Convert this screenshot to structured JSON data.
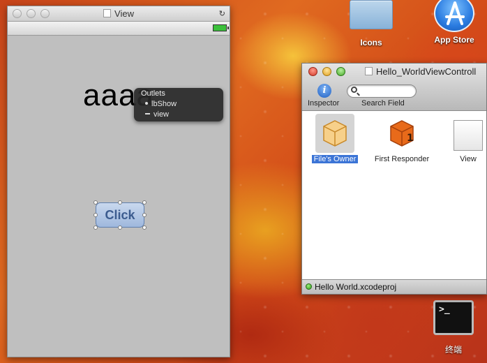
{
  "desktop": {
    "icons_folder_label": "Icons",
    "app_store_label": "App Store",
    "terminal_label": "终端",
    "terminal_prompt": ">_"
  },
  "view_window": {
    "title": "View",
    "label_text": "aaaa",
    "button_label": "Click"
  },
  "outlets_popup": {
    "header": "Outlets",
    "items": [
      "lbShow",
      "view"
    ]
  },
  "doc_window": {
    "title": "Hello_WorldViewControll",
    "inspector_label": "Inspector",
    "search_label": "Search Field",
    "search_value": "",
    "objects": [
      {
        "label": "File's Owner"
      },
      {
        "label": "First Responder"
      },
      {
        "label": "View"
      }
    ],
    "status_text": "Hello World.xcodeproj"
  },
  "colors": {
    "selection": "#3b74d6",
    "button_text": "#3b5b8e"
  }
}
